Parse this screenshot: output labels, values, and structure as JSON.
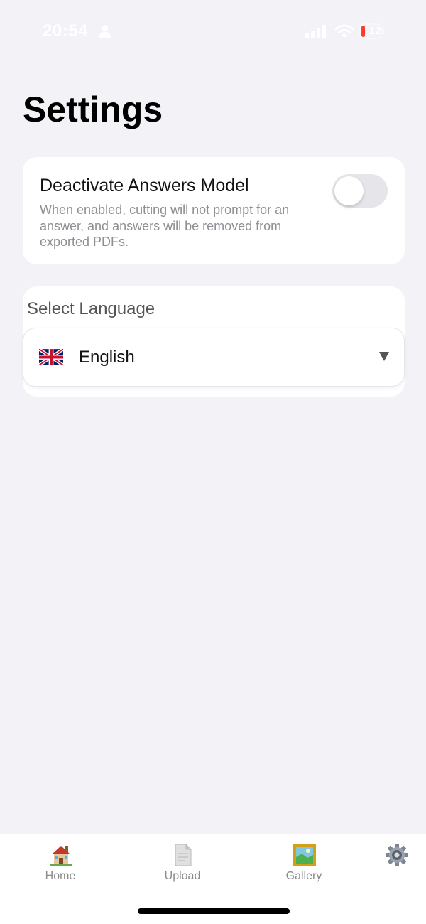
{
  "status_bar": {
    "time": "20:54",
    "battery_level": "12",
    "icons": [
      "person-icon",
      "signal-icon",
      "wifi-icon",
      "battery-icon"
    ]
  },
  "page": {
    "title": "Settings"
  },
  "answers_setting": {
    "title": "Deactivate Answers Model",
    "description": "When enabled, cutting will not prompt for an answer, and answers will be removed from exported PDFs.",
    "enabled": false
  },
  "language_setting": {
    "label": "Select Language",
    "selected": "English",
    "flag": "uk-flag-icon"
  },
  "tab_bar": {
    "tabs": [
      {
        "label": "Home",
        "icon": "house-icon"
      },
      {
        "label": "Upload",
        "icon": "document-icon"
      },
      {
        "label": "Gallery",
        "icon": "picture-frame-icon"
      },
      {
        "label": "",
        "icon": "gear-icon"
      }
    ]
  },
  "colors": {
    "background": "#f2f2f7",
    "card": "#ffffff",
    "toggle_off": "#e5e5ea",
    "secondary_text": "#8e8e93",
    "battery_low": "#ff3b30"
  }
}
